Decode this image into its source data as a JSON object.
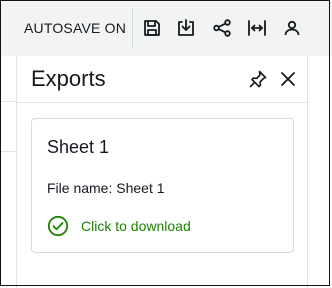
{
  "toolbar": {
    "autosave_label": "AUTOSAVE ON",
    "icons": [
      "save-icon",
      "export-icon",
      "share-icon",
      "fit-width-icon",
      "user-icon"
    ]
  },
  "panel": {
    "title": "Exports",
    "icons": [
      "pin-icon",
      "close-icon"
    ]
  },
  "export_card": {
    "title": "Sheet 1",
    "file_name": "File name: Sheet 1",
    "status_label": "Click to download",
    "status_icon": "check-circle-icon",
    "status_color": "#1d8102"
  }
}
